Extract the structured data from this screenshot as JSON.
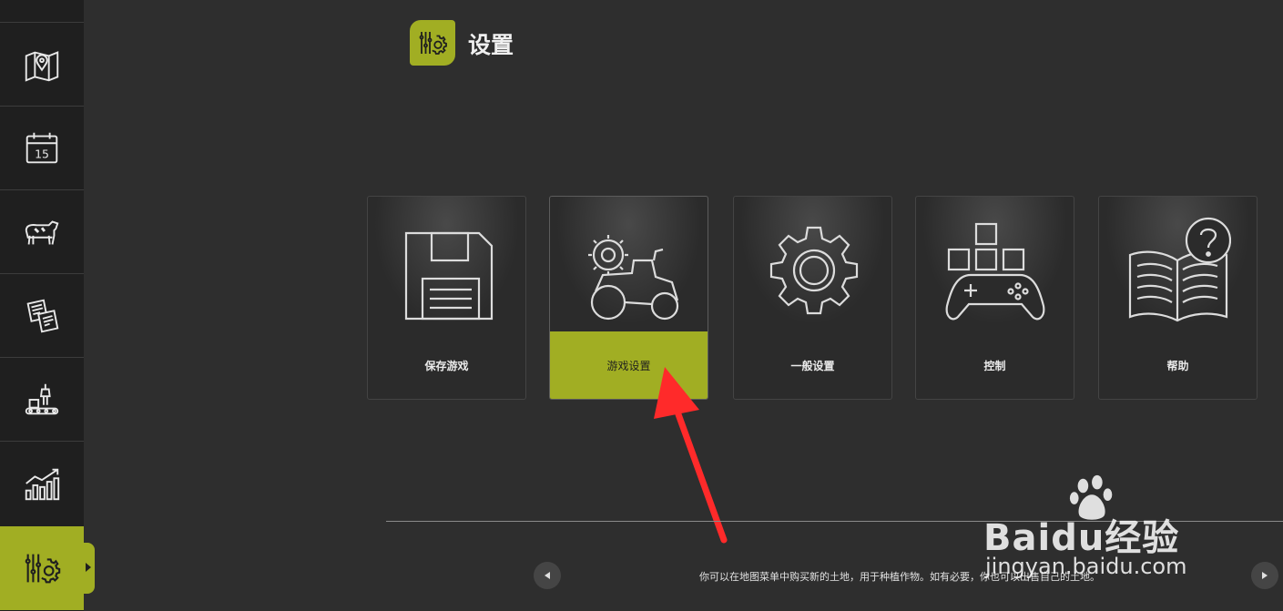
{
  "page": {
    "title": "设置"
  },
  "sidebar": {
    "items": [
      {
        "icon": "map-icon"
      },
      {
        "icon": "calendar-icon",
        "day": "15"
      },
      {
        "icon": "livestock-icon"
      },
      {
        "icon": "contracts-icon"
      },
      {
        "icon": "production-icon"
      },
      {
        "icon": "statistics-icon"
      },
      {
        "icon": "settings-icon",
        "active": true
      }
    ]
  },
  "cards": [
    {
      "label": "保存游戏",
      "icon": "floppy-disk-icon"
    },
    {
      "label": "游戏设置",
      "icon": "tractor-gear-icon",
      "selected": true
    },
    {
      "label": "一般设置",
      "icon": "gear-icon"
    },
    {
      "label": "控制",
      "icon": "gamepad-icon"
    },
    {
      "label": "帮助",
      "icon": "help-book-icon"
    }
  ],
  "footer": {
    "tip": "你可以在地图菜单中购买新的土地，用于种植作物。如有必要，你也可以出售自己的土地。"
  },
  "watermark": {
    "brand": "Baidu经验",
    "url": "jingyan.baidu.com"
  },
  "colors": {
    "accent": "#a1ae23",
    "background": "#2e2e2e",
    "sidebar": "#1f1f1f",
    "arrow": "#ff2a2a"
  }
}
